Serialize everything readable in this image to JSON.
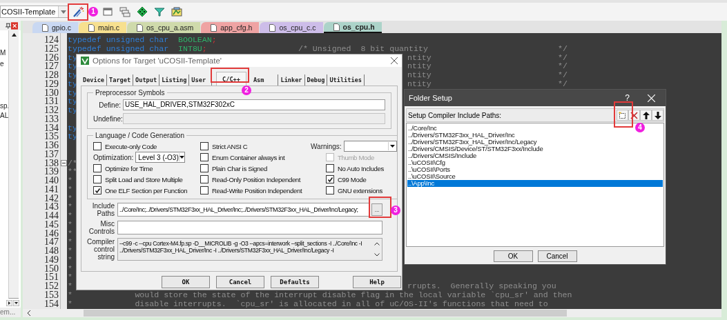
{
  "toolbar": {
    "project": "COSII-Template"
  },
  "project_panel": {
    "items": [
      "M",
      "e",
      "sp.",
      "AL"
    ],
    "footer_tab": "em..."
  },
  "file_tabs": [
    {
      "label": "gpio.c",
      "selected": false,
      "color": "#c9d8f2"
    },
    {
      "label": "main.c",
      "selected": false,
      "color": "#f7e08f"
    },
    {
      "label": "os_cpu_a.asm",
      "selected": false,
      "color": "#cfdaab"
    },
    {
      "label": "app_cfg.h",
      "selected": false,
      "color": "#efa3a3"
    },
    {
      "label": "os_cpu_c.c",
      "selected": false,
      "color": "#cdbde9"
    },
    {
      "label": "os_cpu.h",
      "selected": true,
      "color": "#acd3c9"
    }
  ],
  "editor": {
    "lines": [
      {
        "num": "124",
        "fold": false,
        "parts": [
          {
            "kind": "keyword",
            "text": "typedef unsigned char  "
          },
          {
            "kind": "ident",
            "text": "BOOLEAN"
          },
          {
            "kind": "punct",
            "text": ";"
          }
        ]
      },
      {
        "num": "125",
        "fold": false,
        "parts": [
          {
            "kind": "keyword",
            "text": "typedef unsigned char  "
          },
          {
            "kind": "ident",
            "text": "INT8U"
          },
          {
            "kind": "punct",
            "text": ";"
          },
          {
            "kind": "comment",
            "text": "                   /* Unsigned  8 bit quantity"
          }
        ],
        "end": "*/"
      },
      {
        "num": "126",
        "fold": false,
        "parts": [
          {
            "kind": "keyword",
            "text": "ty"
          }
        ],
        "tail": "ntity",
        "end": "*/"
      },
      {
        "num": "127",
        "fold": false,
        "parts": [
          {
            "kind": "keyword",
            "text": "ty"
          }
        ],
        "tail": "ntity",
        "end": "*/"
      },
      {
        "num": "128",
        "fold": false,
        "parts": [
          {
            "kind": "keyword",
            "text": "ty"
          }
        ],
        "tail": "ntity",
        "end": "*/"
      },
      {
        "num": "129",
        "fold": false,
        "parts": [
          {
            "kind": "keyword",
            "text": "ty"
          }
        ],
        "tail": "ntity",
        "end": "*/"
      },
      {
        "num": "130",
        "fold": false,
        "parts": [
          {
            "kind": "keyword",
            "text": "ty"
          }
        ]
      },
      {
        "num": "131",
        "fold": false,
        "parts": [
          {
            "kind": "keyword",
            "text": "ty"
          }
        ]
      },
      {
        "num": "132",
        "fold": false,
        "parts": [
          {
            "kind": "keyword",
            "text": "ty"
          }
        ]
      },
      {
        "num": "133",
        "fold": false
      },
      {
        "num": "134",
        "fold": false,
        "parts": [
          {
            "kind": "keyword",
            "text": "ty"
          }
        ]
      },
      {
        "num": "135",
        "fold": false,
        "parts": [
          {
            "kind": "keyword",
            "text": "ty"
          }
        ]
      },
      {
        "num": "136",
        "fold": false
      },
      {
        "num": "137",
        "fold": false
      },
      {
        "num": "138",
        "fold": true,
        "parts": [
          {
            "kind": "comment",
            "text": "/*"
          }
        ]
      },
      {
        "num": "139",
        "fold": false,
        "parts": [
          {
            "kind": "comment",
            "text": "**"
          }
        ]
      },
      {
        "num": "140",
        "fold": false,
        "parts": [
          {
            "kind": "comment",
            "text": "*"
          }
        ]
      },
      {
        "num": "141",
        "fold": false,
        "parts": [
          {
            "kind": "comment",
            "text": "*"
          }
        ]
      },
      {
        "num": "142",
        "fold": false,
        "parts": [
          {
            "kind": "comment",
            "text": "*"
          }
        ]
      },
      {
        "num": "143",
        "fold": false,
        "parts": [
          {
            "kind": "comment",
            "text": "*"
          }
        ]
      },
      {
        "num": "144",
        "fold": false,
        "parts": [
          {
            "kind": "comment",
            "text": "*"
          }
        ]
      },
      {
        "num": "145",
        "fold": false,
        "parts": [
          {
            "kind": "comment",
            "text": "*"
          }
        ]
      },
      {
        "num": "146",
        "fold": false,
        "parts": [
          {
            "kind": "comment",
            "text": "*"
          }
        ]
      },
      {
        "num": "147",
        "fold": false,
        "parts": [
          {
            "kind": "comment",
            "text": "*"
          }
        ]
      },
      {
        "num": "148",
        "fold": false,
        "parts": [
          {
            "kind": "comment",
            "text": "*"
          }
        ]
      },
      {
        "num": "149",
        "fold": false,
        "parts": [
          {
            "kind": "comment",
            "text": "*"
          }
        ]
      },
      {
        "num": "150",
        "fold": false,
        "parts": [
          {
            "kind": "comment",
            "text": "*"
          }
        ]
      },
      {
        "num": "151",
        "fold": false,
        "parts": [
          {
            "kind": "comment",
            "text": "*"
          }
        ]
      },
      {
        "num": "152",
        "fold": false,
        "parts": [
          {
            "kind": "comment",
            "text": "*"
          }
        ],
        "tail": "rrupts.  Generally speaking you"
      },
      {
        "num": "153",
        "fold": false,
        "parts": [
          {
            "kind": "comment",
            "text": "*             would store the state of the interrupt disable flag in the local variable `cpu_sr' and then"
          }
        ]
      },
      {
        "num": "154",
        "fold": false,
        "parts": [
          {
            "kind": "comment",
            "text": "*             disable interrupts.  `cpu_sr' is allocated in all of uC/OS-II's functions that need to"
          }
        ]
      }
    ]
  },
  "options_dialog": {
    "title": "Options for Target 'uCOSII-Template'",
    "tabs": [
      {
        "label": "Device",
        "selected": false
      },
      {
        "label": "Target",
        "selected": false
      },
      {
        "label": "Output",
        "selected": false
      },
      {
        "label": "Listing",
        "selected": false
      },
      {
        "label": "User",
        "selected": false
      },
      {
        "label": "C/C++",
        "selected": true
      },
      {
        "label": "Asm",
        "selected": false
      },
      {
        "label": "Linker",
        "selected": false
      },
      {
        "label": "Debug",
        "selected": false
      },
      {
        "label": "Utilities",
        "selected": false
      }
    ],
    "preprocessor": {
      "legend": "Preprocessor Symbols",
      "fields": [
        {
          "label": "Define:",
          "value": "USE_HAL_DRIVER,STM32F302xC",
          "disabled": false
        },
        {
          "label": "Undefine:",
          "disabled": true
        }
      ]
    },
    "codegen": {
      "legend": "Language / Code Generation",
      "columns": [
        [
          {
            "kind": "checkbox",
            "label": "Execute-only Code",
            "checked": false,
            "disabled": false
          },
          {
            "kind": "select",
            "label": "Optimization:",
            "value": "Level 3 (-O3)"
          },
          {
            "kind": "checkbox",
            "label": "Optimize for Time",
            "checked": false,
            "disabled": false
          },
          {
            "kind": "checkbox",
            "label": "Split Load and Store Multiple",
            "checked": false,
            "disabled": false
          },
          {
            "kind": "checkbox",
            "label": "One ELF Section per Function",
            "checked": true,
            "disabled": false
          }
        ],
        [
          {
            "kind": "checkbox",
            "label": "Strict ANSI C",
            "checked": false,
            "disabled": false
          },
          {
            "kind": "checkbox",
            "label": "Enum Container always int",
            "checked": false,
            "disabled": false
          },
          {
            "kind": "checkbox",
            "label": "Plain Char is Signed",
            "checked": false,
            "disabled": false
          },
          {
            "kind": "checkbox",
            "label": "Read-Only Position Independent",
            "checked": false,
            "disabled": false
          },
          {
            "kind": "checkbox",
            "label": "Read-Write Position Independent",
            "checked": false,
            "disabled": false
          }
        ],
        [
          {
            "kind": "select",
            "label": "Warnings:"
          },
          {
            "kind": "checkbox",
            "label": "Thumb Mode",
            "checked": false,
            "disabled": true
          },
          {
            "kind": "checkbox",
            "label": "No Auto Includes",
            "checked": false,
            "disabled": false
          },
          {
            "kind": "checkbox",
            "label": "C99 Mode",
            "checked": true,
            "disabled": false
          },
          {
            "kind": "checkbox",
            "label": "GNU extensions",
            "checked": false,
            "disabled": false
          }
        ]
      ]
    },
    "fields": [
      {
        "kind": "browse",
        "label": "Include Paths",
        "value": "../Core/Inc;../Drivers/STM32F3xx_HAL_Driver/Inc;../Drivers/STM32F3xx_HAL_Driver/Inc/Legacy;",
        "button": "..."
      },
      {
        "kind": "text",
        "label": "Misc Controls"
      },
      {
        "kind": "textarea",
        "label": "Compiler control string",
        "lines": [
          "--c99 -c --cpu Cortex-M4.fp.sp -D__MICROLIB -g -O3 --apcs=interwork --split_sections -I ../Core/Inc -I",
          "../Drivers/STM32F3xx_HAL_Driver/Inc -I ../Drivers/STM32F3xx_HAL_Driver/Inc/Legacy -I"
        ]
      }
    ],
    "buttons": [
      "OK",
      "Cancel",
      "Defaults",
      "Help"
    ]
  },
  "folder_dialog": {
    "title": "Folder Setup",
    "help": "?",
    "label": "Setup Compiler Include Paths:",
    "paths": [
      {
        "text": "../Core/Inc",
        "selected": false
      },
      {
        "text": "../Drivers/STM32F3xx_HAL_Driver/Inc",
        "selected": false
      },
      {
        "text": "../Drivers/STM32F3xx_HAL_Driver/Inc/Legacy",
        "selected": false
      },
      {
        "text": "../Drivers/CMSIS/Device/ST/STM32F3xx/Include",
        "selected": false
      },
      {
        "text": "../Drivers/CMSIS/Include",
        "selected": false
      },
      {
        "text": "..\\uCOSII\\Cfg",
        "selected": false
      },
      {
        "text": "..\\uCOSII\\Ports",
        "selected": false
      },
      {
        "text": "..\\uCOSII\\Source",
        "selected": false
      },
      {
        "text": "..\\App\\Inc",
        "selected": true
      }
    ],
    "buttons": [
      "OK",
      "Cancel"
    ]
  },
  "annotations": [
    "1",
    "2",
    "3",
    "4"
  ]
}
